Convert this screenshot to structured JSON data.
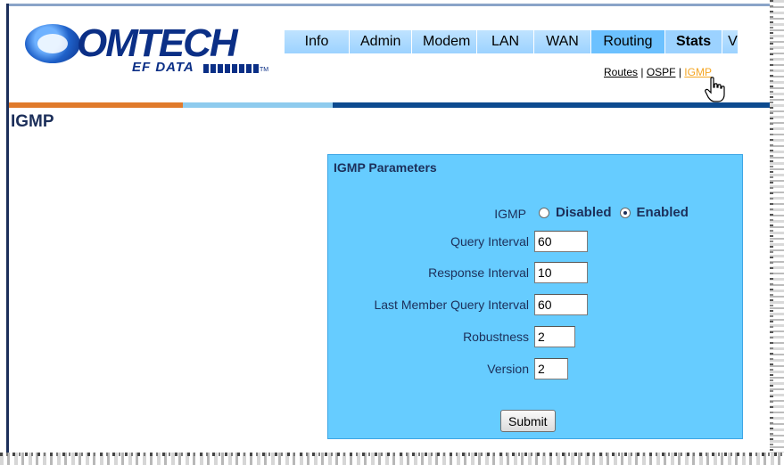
{
  "logo": {
    "main": "OMTECH",
    "sub": "EF DATA"
  },
  "tabs": [
    {
      "label": "Info"
    },
    {
      "label": "Admin"
    },
    {
      "label": "Modem"
    },
    {
      "label": "LAN"
    },
    {
      "label": "WAN"
    },
    {
      "label": "Routing"
    },
    {
      "label": "Stats"
    },
    {
      "label": "V"
    }
  ],
  "subnav": {
    "routes": "Routes",
    "ospf": "OSPF",
    "igmp": "IGMP",
    "sep": " | "
  },
  "page_title": "IGMP",
  "panel": {
    "title": "IGMP Parameters",
    "igmp_label": "IGMP",
    "options": [
      {
        "label": "Disabled",
        "checked": false
      },
      {
        "label": "Enabled",
        "checked": true
      }
    ],
    "fields": [
      {
        "label": "Query Interval",
        "value": "60"
      },
      {
        "label": "Response Interval",
        "value": "10"
      },
      {
        "label": "Last Member Query Interval",
        "value": "60"
      },
      {
        "label": "Robustness",
        "value": "2"
      },
      {
        "label": "Version",
        "value": "2"
      }
    ],
    "submit_label": "Submit"
  },
  "colors": {
    "brand_blue": "#0b2f86",
    "band_orange": "#e07a2b",
    "band_light_blue": "#8ecbee",
    "band_dark_blue": "#0c4a8f",
    "panel_bg": "#66ccff",
    "link_active": "#f5a623"
  }
}
